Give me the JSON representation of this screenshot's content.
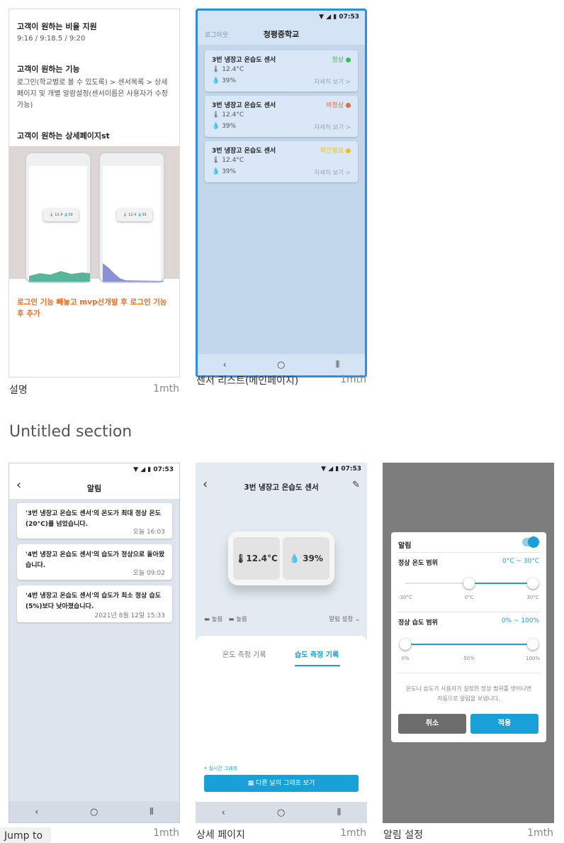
{
  "cards": [
    {
      "title": "설명",
      "age": "1mth"
    },
    {
      "title": "센서 리스트(메인페이지)",
      "age": "1mth"
    },
    {
      "title": "",
      "age": "1mth"
    },
    {
      "title": "상세 페이지",
      "age": "1mth"
    },
    {
      "title": "알림 설정",
      "age": "1mth"
    }
  ],
  "section_title": "Untitled section",
  "jump_to": "Jump to",
  "desc": {
    "h1": "고객이 원하는 비율 지원",
    "ratios": "9:16  /  9:18.5  /  9:20",
    "h2": "고객이 원하는 기능",
    "feature": "로그인(학교별로 볼 수 있도록) > 센서목록 > 상세 페이지 및 개별 알람설정(센서이름은 사용자가 수정 가능)",
    "h3": "고객이 원하는 상세페이지st",
    "note": "로그인 기능 빼놓고 mvp선개발 후 로그인 기능 후 추가"
  },
  "status_time": "07:53",
  "main": {
    "logout": "로그아웃",
    "school": "청평중학교",
    "sensors": [
      {
        "name": "3번 냉장고 온습도 센서",
        "status": "정상",
        "status_color": "#3bbf4b",
        "temp": "12.4°C",
        "hum": "39%",
        "more": "자세히 보기 >"
      },
      {
        "name": "3번 냉장고 온습도 센서",
        "status": "비정상",
        "status_color": "#e8663d",
        "temp": "12.4°C",
        "hum": "39%",
        "more": "자세히 보기 >"
      },
      {
        "name": "3번 냉장고 온습도 센서",
        "status": "확인필요",
        "status_color": "#e6c12a",
        "temp": "12.4°C",
        "hum": "39%",
        "more": "자세히 보기 >"
      }
    ]
  },
  "alerts": {
    "title": "알림",
    "items": [
      {
        "msg": "'3번 냉장고 온습도 센서'의 온도가 최대 정상 온도(20°C)를 넘었습니다.",
        "date": "오늘 16:03"
      },
      {
        "msg": "'4번 냉장고 온습도 센서'의 습도가 정상으로 돌아왔습니다.",
        "date": "오늘 09:02"
      },
      {
        "msg": "'4번 냉장고 온습도 센서'의 습도가 최소 정상 습도(5%)보다 낮아졌습니다.",
        "date": "2021년 8월 12일 15:33"
      }
    ]
  },
  "detail": {
    "title": "3번 냉장고 온습도 센서",
    "temp": "12.4°C",
    "hum": "39%",
    "battery1": "높음",
    "battery2": "높음",
    "alarm_setting": "알림 설정",
    "tab_temp": "온도 측정 기록",
    "tab_hum": "습도 측정 기록",
    "realtime": "• 실시간 그래프",
    "other_day": "다른 날의 그래프 보기"
  },
  "settings": {
    "alarm": "알림",
    "temp_label": "정상 온도 범위",
    "temp_range": "0°C ~ 30°C",
    "temp_ticks": [
      "-30°C",
      "0°C",
      "30°C"
    ],
    "hum_label": "정상 습도 범위",
    "hum_range": "0% ~ 100%",
    "hum_ticks": [
      "0%",
      "50%",
      "100%"
    ],
    "hint": "온도나 습도가 사용자가 설정한 정상 범위를 벗어나면 자동으로 알림을 보냅니다.",
    "cancel": "취소",
    "apply": "적용",
    "accent": "#1aa0d8"
  }
}
